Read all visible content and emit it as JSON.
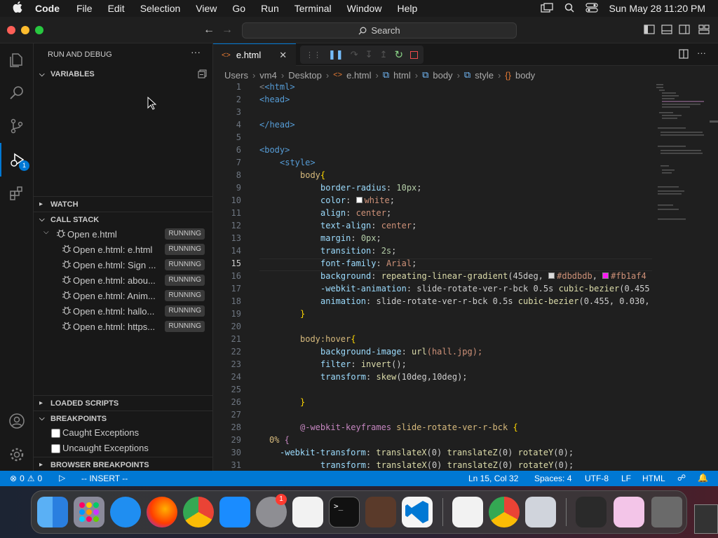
{
  "menubar": {
    "app_name": "Code",
    "items": [
      "File",
      "Edit",
      "Selection",
      "View",
      "Go",
      "Run",
      "Terminal",
      "Window",
      "Help"
    ],
    "datetime": "Sun May 28  11:20 PM"
  },
  "titlebar": {
    "search_label": "Search"
  },
  "activity_bar": {
    "debug_badge": "1"
  },
  "sidebar": {
    "title": "RUN AND DEBUG",
    "variables_label": "VARIABLES",
    "watch_label": "WATCH",
    "call_stack_label": "CALL STACK",
    "call_stack": {
      "root": {
        "label": "Open e.html",
        "status": "RUNNING"
      },
      "threads": [
        {
          "label": "Open e.html: e.html",
          "status": "RUNNING"
        },
        {
          "label": "Open e.html: Sign ...",
          "status": "RUNNING"
        },
        {
          "label": "Open e.html: abou...",
          "status": "RUNNING"
        },
        {
          "label": "Open e.html: Anim...",
          "status": "RUNNING"
        },
        {
          "label": "Open e.html: hallo...",
          "status": "RUNNING"
        },
        {
          "label": "Open e.html: https...",
          "status": "RUNNING"
        }
      ]
    },
    "loaded_scripts_label": "LOADED SCRIPTS",
    "breakpoints_label": "BREAKPOINTS",
    "breakpoints": [
      {
        "label": "Caught Exceptions",
        "checked": false
      },
      {
        "label": "Uncaught Exceptions",
        "checked": false
      }
    ],
    "browser_breakpoints_label": "BROWSER BREAKPOINTS"
  },
  "editor": {
    "tab_label": "e.html",
    "breadcrumb": [
      "Users",
      "vm4",
      "Desktop",
      "e.html",
      "html",
      "body",
      "style",
      "body"
    ],
    "current_line": 15,
    "lines": [
      {
        "n": "1"
      },
      {
        "n": "2"
      },
      {
        "n": "3"
      },
      {
        "n": "4"
      },
      {
        "n": "5"
      },
      {
        "n": "6"
      },
      {
        "n": "7"
      },
      {
        "n": "8"
      },
      {
        "n": "9"
      },
      {
        "n": "10"
      },
      {
        "n": "11"
      },
      {
        "n": "12"
      },
      {
        "n": "13"
      },
      {
        "n": "14"
      },
      {
        "n": "15"
      },
      {
        "n": "16"
      },
      {
        "n": "17"
      },
      {
        "n": "18"
      },
      {
        "n": "19"
      },
      {
        "n": "20"
      },
      {
        "n": "21"
      },
      {
        "n": "22"
      },
      {
        "n": "23"
      },
      {
        "n": "24"
      },
      {
        "n": "25"
      },
      {
        "n": "26"
      },
      {
        "n": "27"
      },
      {
        "n": "28"
      },
      {
        "n": "29"
      },
      {
        "n": "30"
      },
      {
        "n": "31"
      }
    ],
    "code": {
      "l1": "<html>",
      "l2": "<head>",
      "l4": "</head>",
      "l6": "<body>",
      "l7": "<style>",
      "l8a": "body",
      "l8b": "{",
      "l9a": "border-radius",
      "l9b": ": ",
      "l9c": "10px",
      "l9d": ";",
      "l10a": "color",
      "l10b": ": ",
      "l10c": "white",
      "l10d": ";",
      "l11a": "align",
      "l11b": ": ",
      "l11c": "center",
      "l11d": ";",
      "l12a": "text-align",
      "l12b": ": ",
      "l12c": "center",
      "l12d": ";",
      "l13a": "margin",
      "l13b": ": ",
      "l13c": "0px",
      "l13d": ";",
      "l14a": "transition",
      "l14b": ": ",
      "l14c": "2s",
      "l14d": ";",
      "l15a": "font-family",
      "l15b": ": ",
      "l15c": "Arial",
      "l15d": ";",
      "l16a": "background",
      "l16b": ": ",
      "l16c": "repeating-linear-gradient",
      "l16d": "(45deg, ",
      "l16e": "#dbdbdb",
      "l16f": ", ",
      "l16g": "#fb1af4",
      "l17a": "-webkit-animation",
      "l17b": ": slide-rotate-ver-r-bck 0.5s ",
      "l17c": "cubic-bezier",
      "l17d": "(0.455",
      "l18a": "animation",
      "l18b": ": slide-rotate-ver-r-bck 0.5s ",
      "l18c": "cubic-bezier",
      "l18d": "(0.455, 0.030,",
      "l19": "}",
      "l21a": "body:hover",
      "l21b": "{",
      "l22a": "background-image",
      "l22b": ": ",
      "l22c": "url",
      "l22d": "(hall.jpg);",
      "l23a": "filter",
      "l23b": ": ",
      "l23c": "invert",
      "l23d": "();",
      "l24a": "transform",
      "l24b": ": ",
      "l24c": "skew",
      "l24d": "(10deg,10deg);",
      "l26": "}",
      "l28a": "@-webkit-keyframes",
      "l28b": " slide-rotate-ver-r-bck ",
      "l28c": "{",
      "l29a": "0%",
      "l29b": " {",
      "l30a": "-webkit-transform",
      "l30b": ": ",
      "l30c": "translateX",
      "l30d": "(0) ",
      "l30e": "translateZ",
      "l30f": "(0) ",
      "l30g": "rotateY",
      "l30h": "(0);",
      "l31a": "transform",
      "l31b": ": ",
      "l31c": "translateX",
      "l31d": "(0) ",
      "l31e": "translateZ",
      "l31f": "(0) ",
      "l31g": "rotateY",
      "l31h": "(0);"
    }
  },
  "statusbar": {
    "errors": "0",
    "warnings": "0",
    "mode": "-- INSERT --",
    "position": "Ln 15, Col 32",
    "spaces": "Spaces: 4",
    "encoding": "UTF-8",
    "eol": "LF",
    "language": "HTML"
  },
  "dock": {
    "settings_badge": "1"
  },
  "colors": {
    "accent": "#0078d4",
    "status_bar": "#0078d4",
    "swatch_white": "#ffffff",
    "swatch_gray": "#dbdbdb",
    "swatch_pink": "#fb1af4"
  }
}
